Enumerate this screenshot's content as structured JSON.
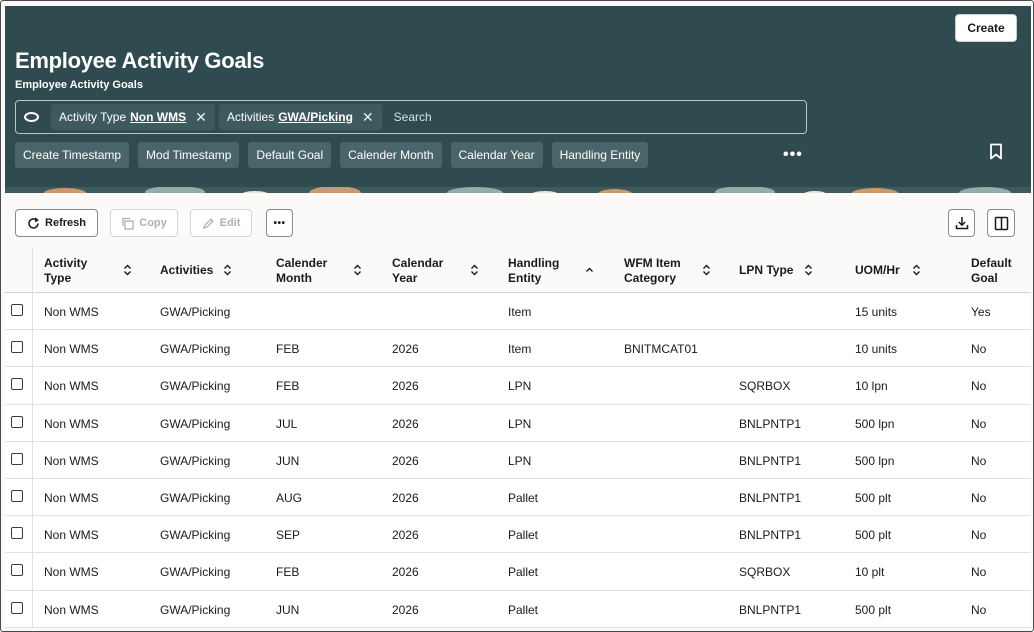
{
  "header": {
    "create_label": "Create",
    "title": "Employee Activity Goals",
    "subtitle": "Employee Activity Goals",
    "search": {
      "chips": [
        {
          "label": "Activity Type",
          "value": "Non WMS"
        },
        {
          "label": "Activities",
          "value": "GWA/Picking"
        }
      ],
      "placeholder": "Search"
    },
    "filters": [
      "Create Timestamp",
      "Mod Timestamp",
      "Default Goal",
      "Calender Month",
      "Calendar Year",
      "Handling Entity"
    ],
    "more_label": "•••"
  },
  "toolbar": {
    "refresh_label": "Refresh",
    "copy_label": "Copy",
    "edit_label": "Edit",
    "more_label": "•••"
  },
  "table": {
    "columns": [
      {
        "line1": "Activity",
        "line2": "Type",
        "sort": "both"
      },
      {
        "line1": "Activities",
        "line2": "",
        "sort": "both"
      },
      {
        "line1": "Calender",
        "line2": "Month",
        "sort": "both"
      },
      {
        "line1": "Calendar",
        "line2": "Year",
        "sort": "both"
      },
      {
        "line1": "Handling",
        "line2": "Entity",
        "sort": "asc"
      },
      {
        "line1": "WFM Item",
        "line2": "Category",
        "sort": "both"
      },
      {
        "line1": "LPN Type",
        "line2": "",
        "sort": "both"
      },
      {
        "line1": "UOM/Hr",
        "line2": "",
        "sort": "both"
      },
      {
        "line1": "Default",
        "line2": "Goal",
        "sort": "none"
      }
    ],
    "rows": [
      [
        "Non WMS",
        "GWA/Picking",
        "",
        "",
        "Item",
        "",
        "",
        "15 units",
        "Yes"
      ],
      [
        "Non WMS",
        "GWA/Picking",
        "FEB",
        "2026",
        "Item",
        "BNITMCAT01",
        "",
        "10 units",
        "No"
      ],
      [
        "Non WMS",
        "GWA/Picking",
        "FEB",
        "2026",
        "LPN",
        "",
        "SQRBOX",
        "10 lpn",
        "No"
      ],
      [
        "Non WMS",
        "GWA/Picking",
        "JUL",
        "2026",
        "LPN",
        "",
        "BNLPNTP1",
        "500 lpn",
        "No"
      ],
      [
        "Non WMS",
        "GWA/Picking",
        "JUN",
        "2026",
        "LPN",
        "",
        "BNLPNTP1",
        "500 lpn",
        "No"
      ],
      [
        "Non WMS",
        "GWA/Picking",
        "AUG",
        "2026",
        "Pallet",
        "",
        "BNLPNTP1",
        "500 plt",
        "No"
      ],
      [
        "Non WMS",
        "GWA/Picking",
        "SEP",
        "2026",
        "Pallet",
        "",
        "BNLPNTP1",
        "500 plt",
        "No"
      ],
      [
        "Non WMS",
        "GWA/Picking",
        "FEB",
        "2026",
        "Pallet",
        "",
        "SQRBOX",
        "10 plt",
        "No"
      ],
      [
        "Non WMS",
        "GWA/Picking",
        "JUN",
        "2026",
        "Pallet",
        "",
        "BNLPNTP1",
        "500 plt",
        "No"
      ]
    ]
  },
  "colors": {
    "header_bg": "#2f4b50",
    "chip_bg": "#3e5a5f",
    "page_bg": "#fbfaf8"
  },
  "icons": [
    "oval-icon",
    "close-icon",
    "bookmark-icon",
    "refresh-icon",
    "copy-icon",
    "edit-icon",
    "more-icon",
    "download-icon",
    "columns-icon",
    "sort-icon",
    "checkbox-icon"
  ]
}
